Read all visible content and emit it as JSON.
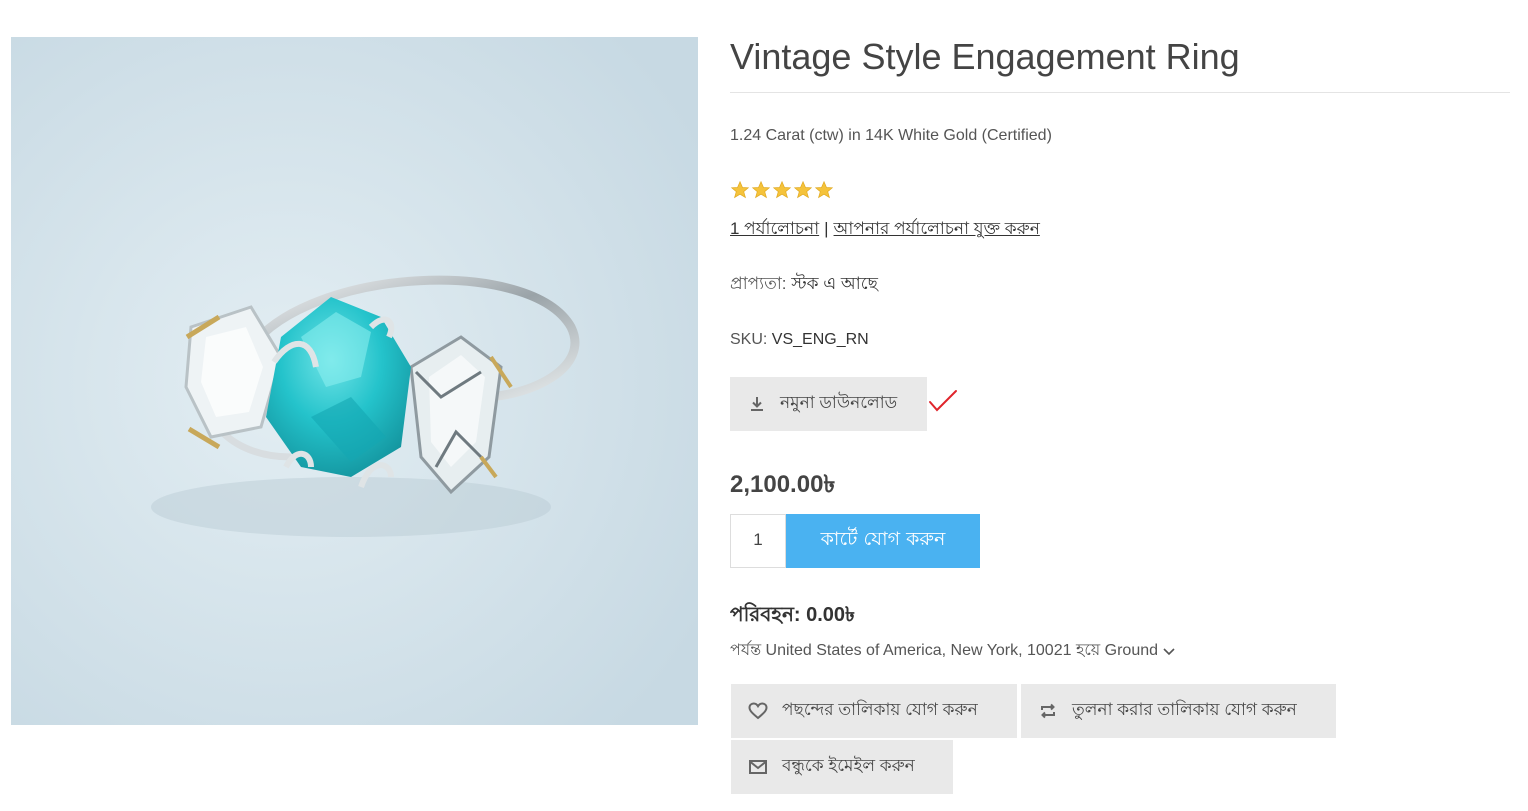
{
  "product": {
    "title": "Vintage Style Engagement Ring",
    "short_description": "1.24 Carat (ctw) in 14K White Gold (Certified)",
    "rating": 5,
    "rating_max": 5,
    "reviews_link": "1 পর্যালোচনা",
    "reviews_separator": "|",
    "add_review_link": "আপনার পর্যালোচনা যুক্ত করুন",
    "availability_label": "প্রাপ্যতা:",
    "availability_value": "স্টক এ আছে",
    "sku_label": "SKU:",
    "sku_value": "VS_ENG_RN",
    "sample_download_label": "নমুনা ডাউনলোড",
    "price": "2,100.00৳",
    "quantity": "1",
    "add_to_cart_label": "কার্টে যোগ করুন",
    "shipping_label": "পরিবহন:",
    "shipping_value": "0.00৳",
    "shipping_destination": "পর্যন্ত United States of America, New York, 10021 হয়ে Ground",
    "wishlist_label": "পছন্দের তালিকায় যোগ করুন",
    "compare_label": "তুলনা করার তালিকায় যোগ করুন",
    "email_friend_label": "বন্ধুকে ইমেইল করুন"
  },
  "colors": {
    "accent": "#4ab2f1",
    "star": "#f5c33b",
    "button_bg": "#e9e9e9",
    "checkmark": "#e0242b"
  },
  "icons": {
    "download": "download-icon",
    "heart": "heart-icon",
    "compare": "compare-arrows-icon",
    "email": "envelope-icon",
    "chevron": "chevron-down-icon",
    "star": "star-icon"
  }
}
